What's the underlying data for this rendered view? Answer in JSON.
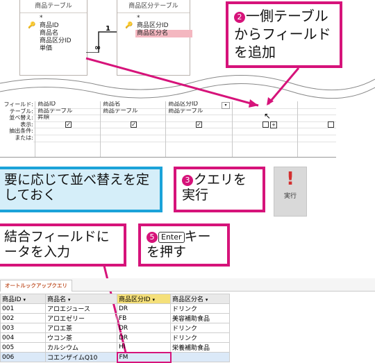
{
  "design": {
    "tables": [
      {
        "name": "商品テーブル",
        "fields": [
          "*",
          "商品ID",
          "商品名",
          "商品区分ID",
          "単価"
        ]
      },
      {
        "name": "商品区分テーブル",
        "fields": [
          "*",
          "商品区分ID",
          "商品区分名"
        ]
      }
    ],
    "relation": {
      "one": "1",
      "many": "∞"
    }
  },
  "grid": {
    "labels": [
      "フィールド:",
      "テーブル:",
      "並べ替え:",
      "表示:",
      "抽出条件:",
      "または:"
    ],
    "columns": [
      {
        "field": "商品ID",
        "table": "商品テーブル",
        "sort": "昇順"
      },
      {
        "field": "商品名",
        "table": "商品テーブル",
        "sort": ""
      },
      {
        "field": "商品区分ID",
        "table": "商品テーブル",
        "sort": ""
      },
      {
        "field": "",
        "table": "",
        "sort": ""
      }
    ]
  },
  "callouts": {
    "c2_num": "2",
    "c2_text": "一側テーブルからフィールドを追加",
    "c_sort": "要に応じて並べ替えを定しておく",
    "c3_num": "3",
    "c3_text": "クエリを実行",
    "c4_text": "結合フィールドにータを入力",
    "c5_num": "5",
    "c5_key": "Enter",
    "c5_text": "キーを押す"
  },
  "ribbon": {
    "exec_label": "実行",
    "exec_icon": "exclamation-icon"
  },
  "datasheet": {
    "tab": "オートルックアップクエリ",
    "headers": [
      "商品ID",
      "商品名",
      "商品区分ID",
      "商品区分名"
    ],
    "rows": [
      [
        "001",
        "アロエジュース",
        "DR",
        "ドリンク"
      ],
      [
        "002",
        "アロエゼリー",
        "FB",
        "美容補助食品"
      ],
      [
        "003",
        "アロエ茶",
        "DR",
        "ドリンク"
      ],
      [
        "004",
        "ウコン茶",
        "DR",
        "ドリンク"
      ],
      [
        "005",
        "カルシウム",
        "HI",
        "栄養補助食品"
      ],
      [
        "006",
        "コエンザイムQ10",
        "FM",
        ""
      ]
    ]
  },
  "colors": {
    "accent": "#d6137a",
    "blue": "#1ba3d9"
  }
}
